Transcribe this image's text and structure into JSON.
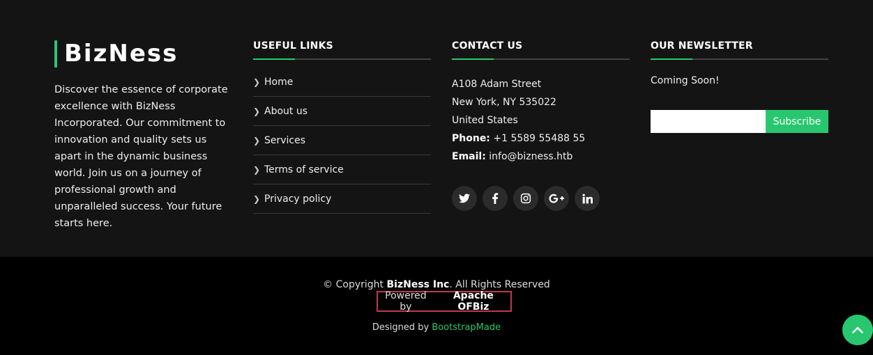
{
  "brand": {
    "name": "BizNess",
    "accent": "#28c76f",
    "description": "Discover the essence of corporate excellence with BizNess Incorporated. Our commitment to innovation and quality sets us apart in the dynamic business world. Join us on a journey of professional growth and unparalleled success. Your future starts here."
  },
  "useful_links": {
    "heading": "USEFUL LINKS",
    "items": [
      "Home",
      "About us",
      "Services",
      "Terms of service",
      "Privacy policy"
    ]
  },
  "contact": {
    "heading": "CONTACT US",
    "address1": "A108 Adam Street",
    "address2": "New York, NY 535022",
    "country": "United States",
    "phone_label": "Phone:",
    "phone": "+1 5589 55488 55",
    "email_label": "Email:",
    "email": "info@bizness.htb",
    "social": [
      "twitter-icon",
      "facebook-icon",
      "instagram-icon",
      "google-plus-icon",
      "linkedin-icon"
    ]
  },
  "newsletter": {
    "heading": "OUR NEWSLETTER",
    "text": "Coming Soon!",
    "input_value": "",
    "button": "Subscribe"
  },
  "bottom": {
    "copyright_prefix": "© Copyright ",
    "company": "BizNess Inc",
    "rights": ". All Rights Reserved",
    "powered_prefix": "Powered by",
    "powered_name": "Apache OFBiz",
    "designed_prefix": "Designed by ",
    "designed_name": "BootstrapMade"
  }
}
